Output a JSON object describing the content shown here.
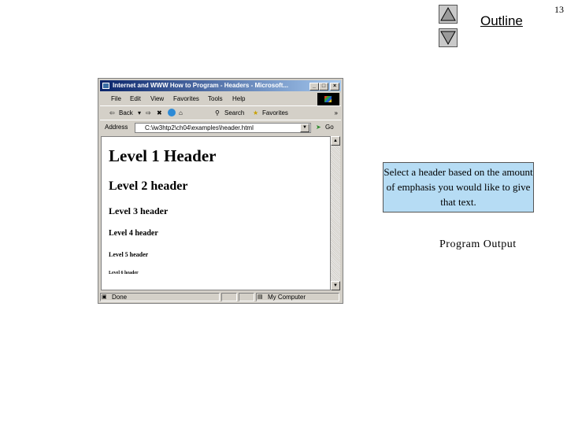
{
  "slide": {
    "outline_link": "Outline",
    "page_number": "13",
    "callout_text": "Select a header based on the amount of emphasis you would like to give that text.",
    "caption": "Program Output",
    "nav_up_icon": "up-triangle-icon",
    "nav_down_icon": "down-triangle-icon"
  },
  "browser": {
    "title": "Internet and WWW How to Program - Headers - Microsoft...",
    "window_buttons": [
      "_",
      "□",
      "×"
    ],
    "menu": [
      "File",
      "Edit",
      "View",
      "Favorites",
      "Tools",
      "Help"
    ],
    "toolbar": {
      "back": "Back",
      "search": "Search",
      "favorites": "Favorites",
      "more": "»"
    },
    "address_label": "Address",
    "address_value": "C:\\iw3htp2\\ch04\\examples\\header.html",
    "go_label": "Go",
    "headers": [
      "Level 1 Header",
      "Level 2 header",
      "Level 3 header",
      "Level 4 header",
      "Level 5 header",
      "Level 6 header"
    ],
    "status": {
      "left": "Done",
      "zone": "My Computer"
    }
  },
  "colors": {
    "callout_bg": "#b6dcf4",
    "title_bar_start": "#0a246a",
    "title_bar_end": "#a6caf0",
    "chrome": "#d4d0c8"
  }
}
